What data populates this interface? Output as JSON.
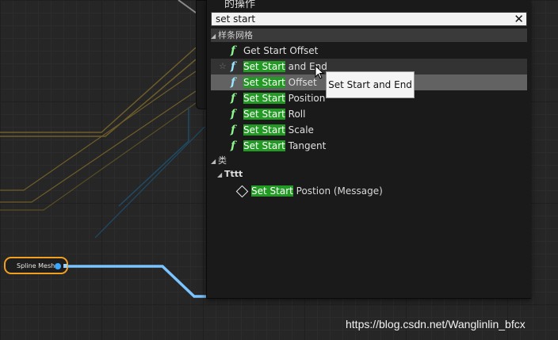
{
  "menu": {
    "title": "的操作",
    "search": {
      "value": "set start"
    },
    "category_spline": "样条网格",
    "items": [
      {
        "hl": "",
        "rest": "Get Start Offset"
      },
      {
        "hl": "Set Start",
        "rest": " and End"
      },
      {
        "hl": "Set Start",
        "rest": " Offset"
      },
      {
        "hl": "Set Start",
        "rest": " Position"
      },
      {
        "hl": "Set Start",
        "rest": " Roll"
      },
      {
        "hl": "Set Start",
        "rest": " Scale"
      },
      {
        "hl": "Set Start",
        "rest": " Tangent"
      }
    ],
    "category_class": "类",
    "subcategory": "Tttt",
    "message_item": {
      "hl": "Set Start",
      "rest": " Postion (Message)"
    }
  },
  "tooltip": "Set Start and End",
  "node": {
    "label": "Spline Mesh"
  },
  "watermark": "https://blog.csdn.net/Wanglinlin_bfcx",
  "colors": {
    "highlight": "#229a23",
    "selection": "#626262",
    "node_border": "#f0a020",
    "wire": "#7cc4ff"
  },
  "icons": {
    "function": "function-icon",
    "message": "message-icon",
    "favorite": "star-icon",
    "close": "close-icon"
  }
}
